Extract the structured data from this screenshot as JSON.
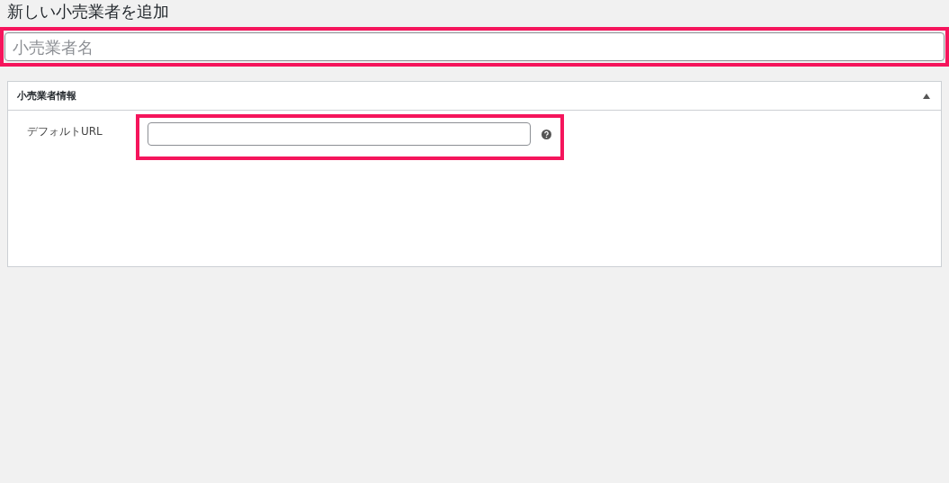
{
  "page_title": "新しい小売業者を追加",
  "name_field": {
    "placeholder": "小売業者名",
    "highlighted": true
  },
  "panel": {
    "title": "小売業者情報",
    "expanded": true,
    "fields": [
      {
        "label": "デフォルトURL",
        "highlighted": true,
        "has_help": true
      }
    ]
  }
}
